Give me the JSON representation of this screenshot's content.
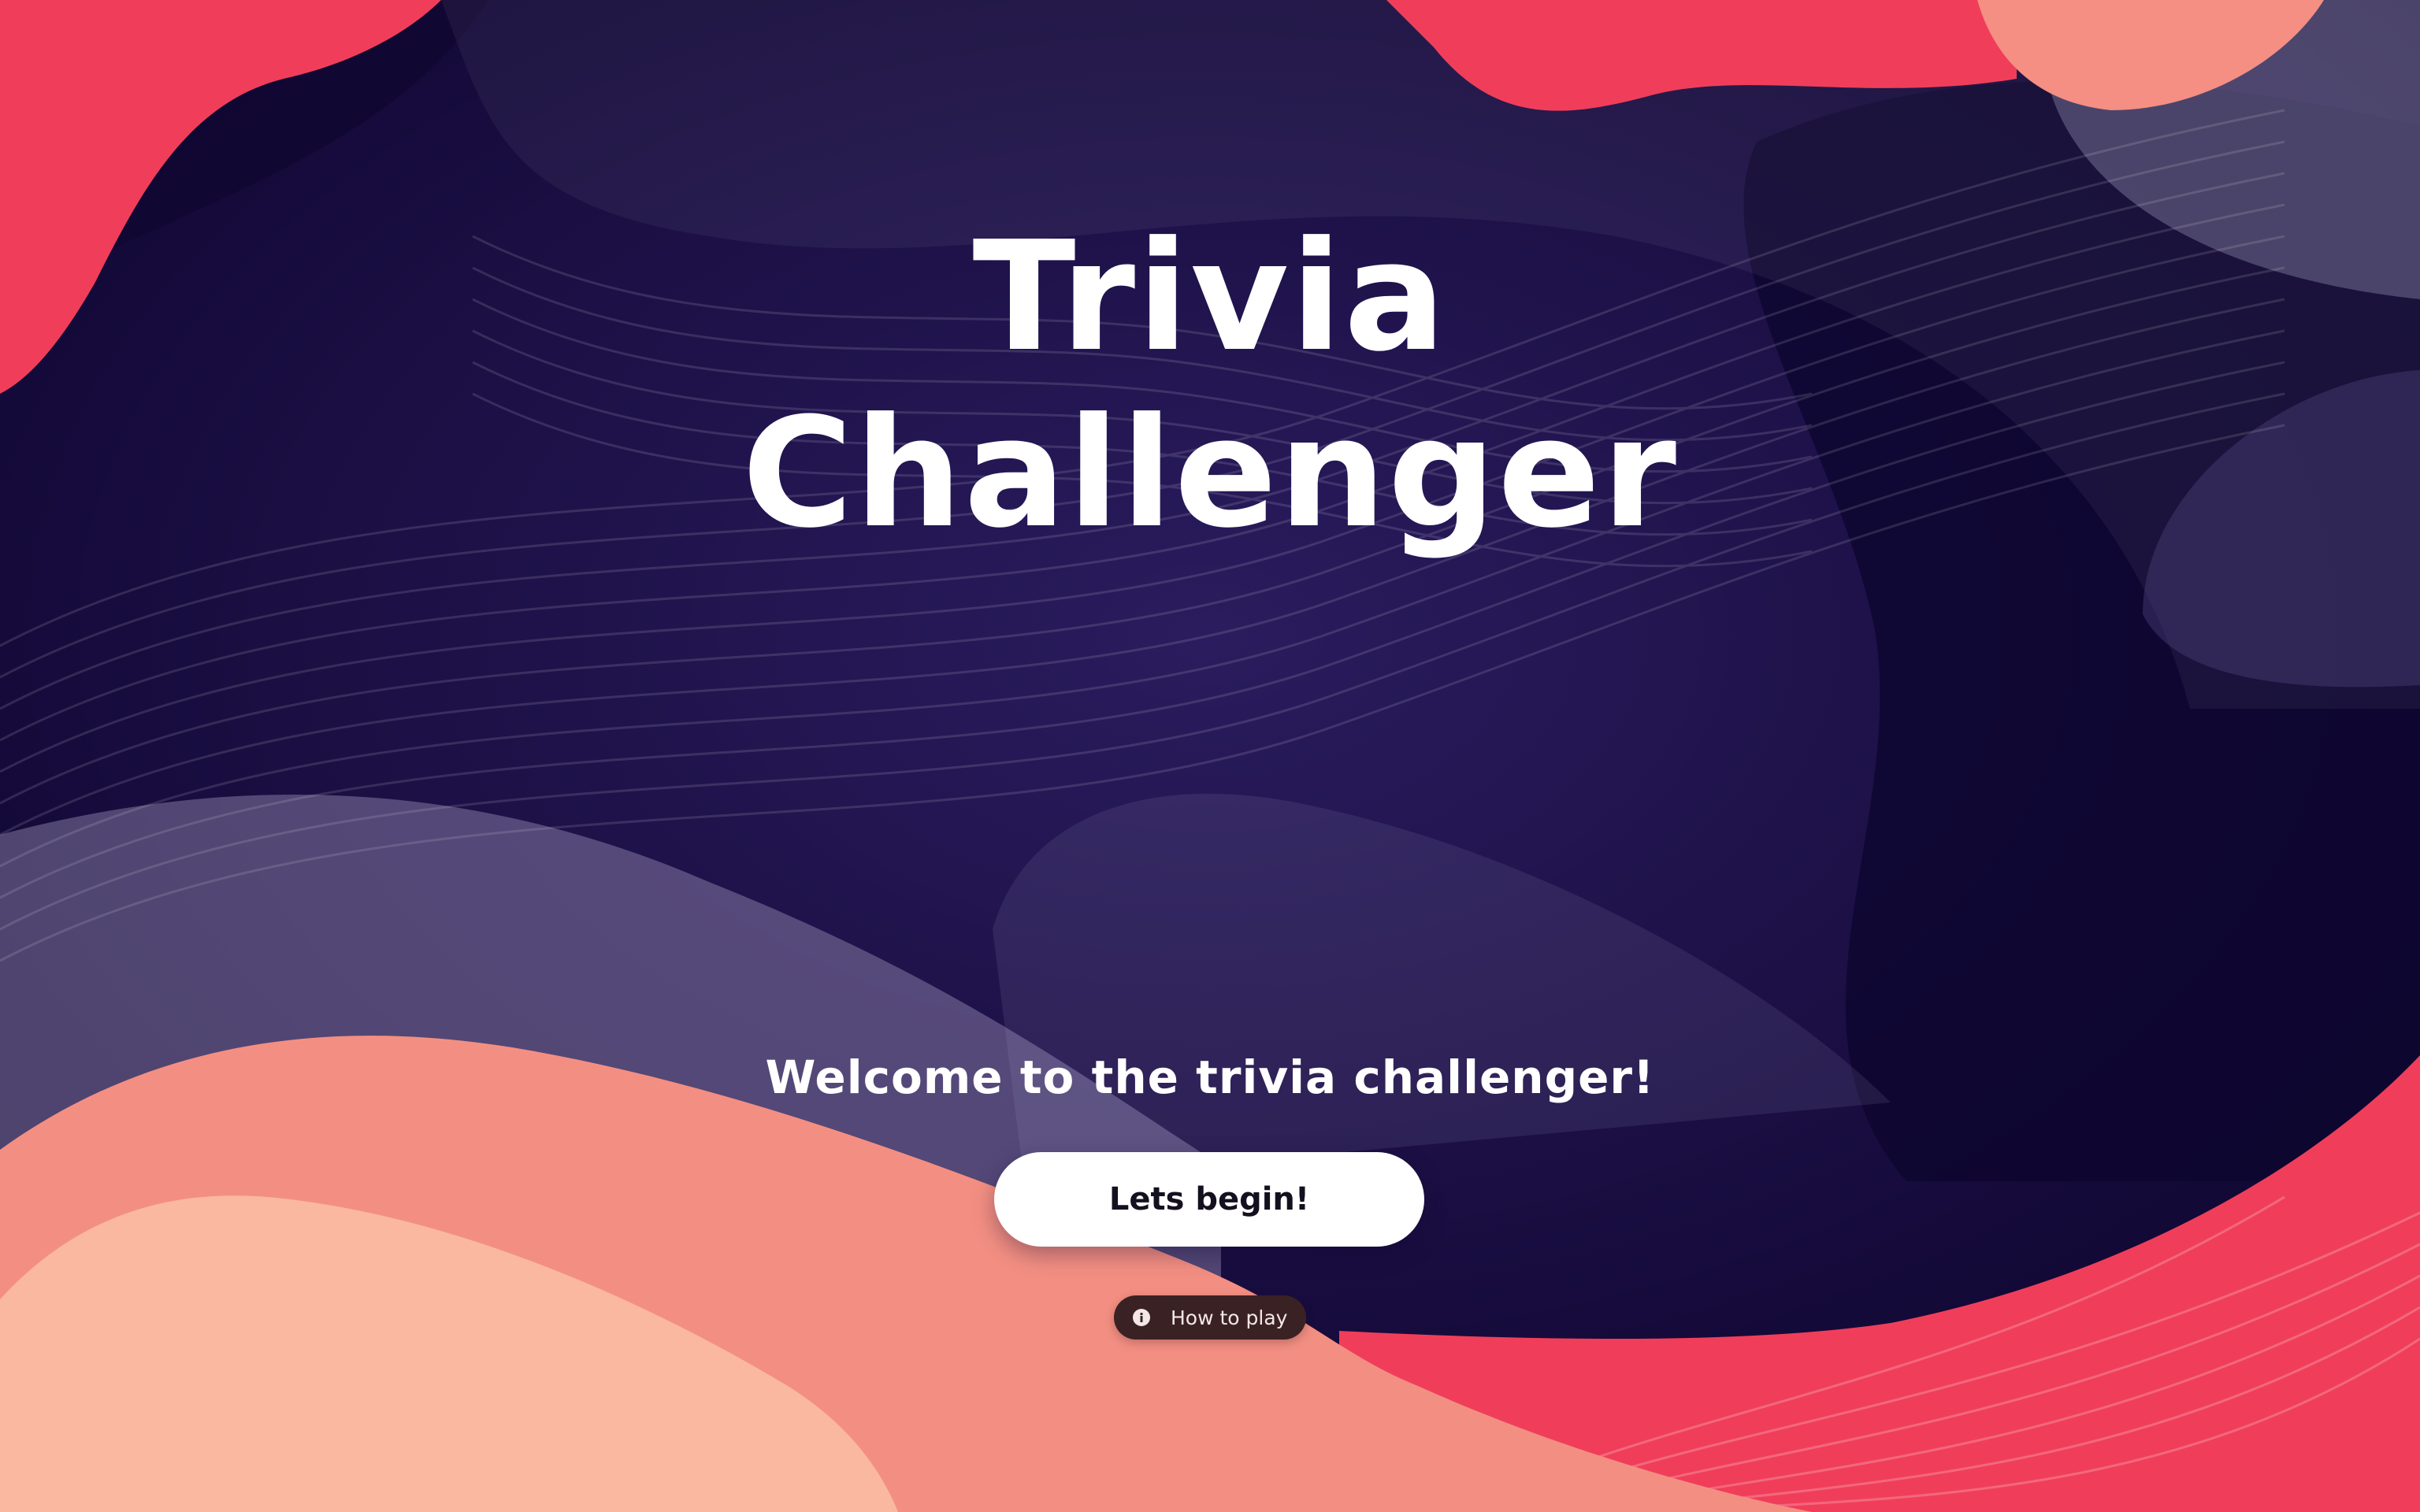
{
  "hero": {
    "title_line1": "Trivia",
    "title_line2": "Challenger",
    "welcome": "Welcome to the trivia challenger!"
  },
  "actions": {
    "begin_label": "Lets begin!",
    "howto_label": "How to play",
    "howto_icon": "info-icon"
  },
  "colors": {
    "background_dark": "#170c3d",
    "coral": "#f03e5a",
    "salmon": "#f38f82",
    "peach": "#fab8a1",
    "button": "#ffffff",
    "pill": "#3a2224"
  }
}
